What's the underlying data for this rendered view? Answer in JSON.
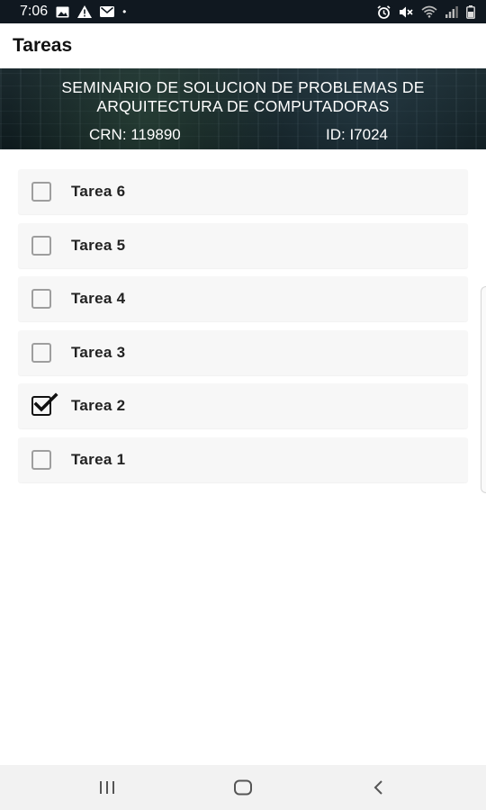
{
  "status_bar": {
    "time": "7:06",
    "left_icons": [
      "image-icon",
      "warning-icon",
      "mail-icon"
    ],
    "dot": "•",
    "right_icons": [
      "alarm-icon",
      "mute-icon",
      "wifi-icon",
      "signal-icon",
      "battery-icon"
    ]
  },
  "app_bar": {
    "title": "Tareas"
  },
  "banner": {
    "line1": "SEMINARIO DE SOLUCION DE PROBLEMAS DE",
    "line2": "ARQUITECTURA DE COMPUTADORAS",
    "crn": "CRN: 119890",
    "id": "ID: I7024"
  },
  "tasks": [
    {
      "label": "Tarea 6",
      "checked": false
    },
    {
      "label": "Tarea 5",
      "checked": false
    },
    {
      "label": "Tarea 4",
      "checked": false
    },
    {
      "label": "Tarea 3",
      "checked": false
    },
    {
      "label": "Tarea 2",
      "checked": true
    },
    {
      "label": "Tarea 1",
      "checked": false
    }
  ],
  "nav_bar": {
    "icons": [
      "recent-apps-icon",
      "home-icon",
      "back-icon"
    ]
  },
  "colors": {
    "status_bar": "#101820",
    "task_background": "#f7f7f7",
    "checkbox_border": "#9e9e9e",
    "nav_bar": "#f2f2f2"
  }
}
